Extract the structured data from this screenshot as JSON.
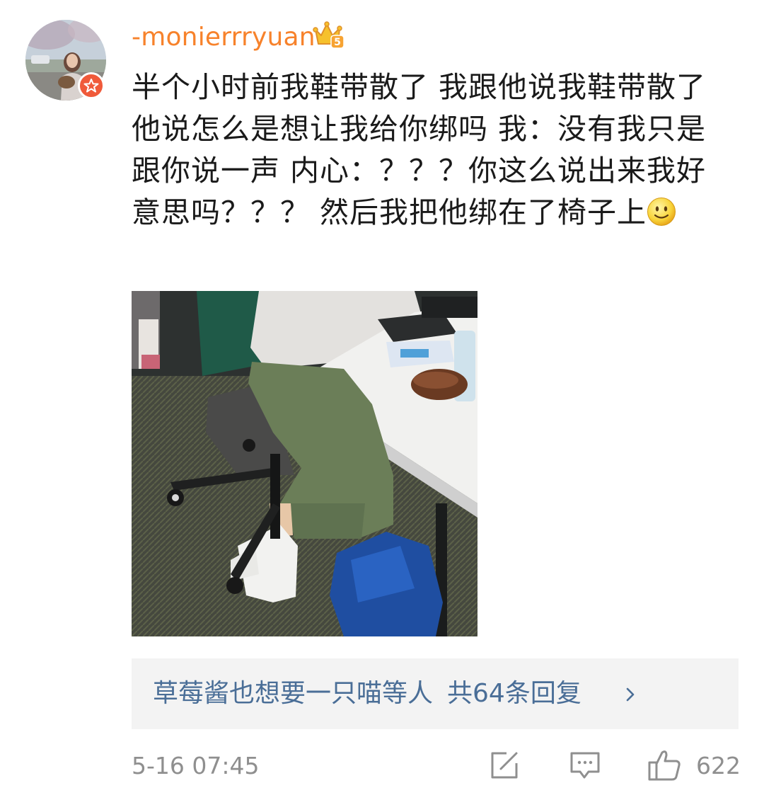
{
  "post": {
    "username": "-monierrryuan",
    "text": "半个小时前我鞋带散了 我跟他说我鞋带散了 他说怎么是想让我给你绑吗 我：没有我只是跟你说一声 内心：？？？你这么说出来我好意思吗？？？ 然后我把他绑在了椅子上",
    "emoji": "smile-face"
  },
  "replies": {
    "names": "草莓酱也想要一只喵等人",
    "count_label": "共64条回复"
  },
  "footer": {
    "timestamp": "5-16 07:45",
    "like_count": "622"
  },
  "icons": {
    "verify": "verified-star-badge",
    "vip": "crown-vip-icon",
    "share": "share-icon",
    "comment": "comment-icon",
    "like": "thumbs-up-icon",
    "chevron": "chevron-right-icon"
  },
  "colors": {
    "username": "#f7822b",
    "reply_link": "#4a6e97",
    "meta": "#8f8f8f",
    "badge": "#f05a3a"
  }
}
